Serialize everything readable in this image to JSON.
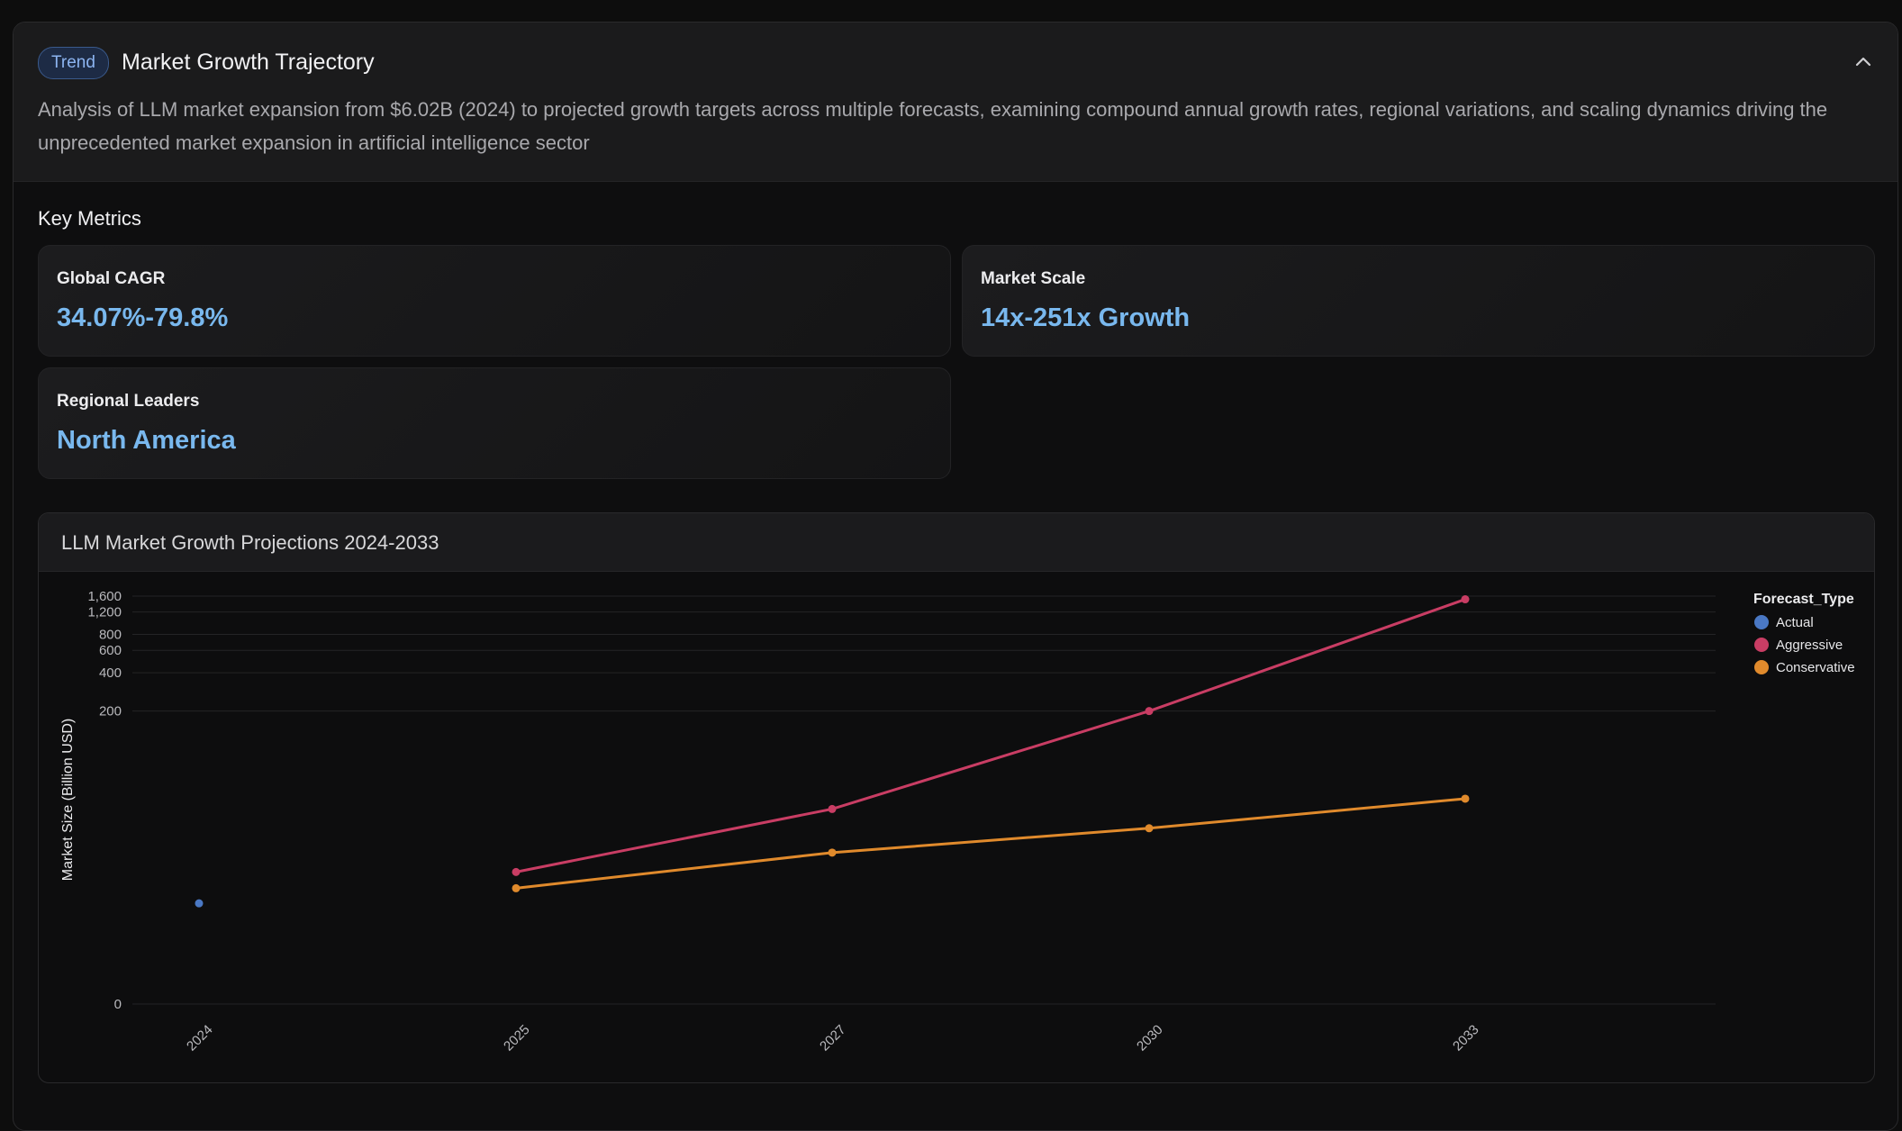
{
  "header": {
    "badge": "Trend",
    "title": "Market Growth Trajectory",
    "description": "Analysis of LLM market expansion from $6.02B (2024) to projected growth targets across multiple forecasts, examining compound annual growth rates, regional variations, and scaling dynamics driving the unprecedented market expansion in artificial intelligence sector",
    "collapse_icon": "chevron-up-icon"
  },
  "key_metrics": {
    "label": "Key Metrics",
    "cards": [
      {
        "label": "Global CAGR",
        "value": "34.07%-79.8%"
      },
      {
        "label": "Market Scale",
        "value": "14x-251x Growth"
      },
      {
        "label": "Regional Leaders",
        "value": "North America"
      }
    ]
  },
  "colors": {
    "accent_value": "#79b8ee",
    "actual": "#4a78c4",
    "aggressive": "#c93d64",
    "conservative": "#e08a2c"
  },
  "chart_data": {
    "type": "line",
    "title": "LLM Market Growth Projections 2024-2033",
    "xlabel": "",
    "ylabel": "Market Size (Billion USD)",
    "y_scale": "symlog",
    "y_ticks": [
      0,
      200,
      400,
      600,
      800,
      1200,
      1600
    ],
    "y_tick_labels": [
      "0",
      "200",
      "400",
      "600",
      "800",
      "1,200",
      "1,600"
    ],
    "categories": [
      "2024",
      "2025",
      "2027",
      "2030",
      "2033"
    ],
    "grid": true,
    "legend_title": "Forecast_Type",
    "legend_position": "top-right",
    "series": [
      {
        "name": "Actual",
        "values": [
          6.02,
          null,
          null,
          null,
          null
        ]
      },
      {
        "name": "Aggressive",
        "values": [
          null,
          10.8,
          34,
          200,
          1510
        ]
      },
      {
        "name": "Conservative",
        "values": [
          null,
          8.0,
          15.4,
          24,
          41
        ]
      }
    ]
  }
}
